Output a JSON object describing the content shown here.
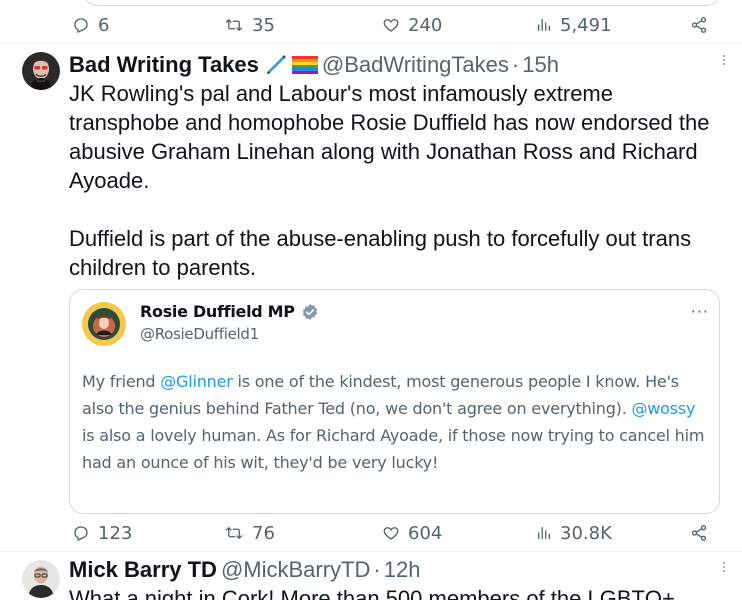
{
  "previous_tweet": {
    "actions": {
      "replies": "6",
      "retweets": "35",
      "likes": "240",
      "views": "5,491"
    }
  },
  "tweet1": {
    "author_name": "Bad Writing Takes",
    "author_emoji": [
      "pen-icon",
      "rainbow-flag-icon"
    ],
    "handle": "@BadWritingTakes",
    "separator": "·",
    "time": "15h",
    "paragraphs": [
      "JK Rowling's pal and Labour's most infamously extreme transphobe and homophobe Rosie Duffield has now endorsed the abusive Graham Linehan along with Jonathan Ross and Richard Ayoade.",
      "Duffield is part of the abuse-enabling push to forcefully out trans children to parents."
    ],
    "quoted": {
      "author_name": "Rosie Duffield MP",
      "verified": true,
      "handle": "@RosieDuffield1",
      "more": "···",
      "text_segments": [
        {
          "text": "My friend ",
          "mention": false
        },
        {
          "text": "@Glinner",
          "mention": true
        },
        {
          "text": " is one of the kindest, most generous people I know. He's also the genius behind Father Ted (no, we don't agree on everything). ",
          "mention": false
        },
        {
          "text": "@wossy",
          "mention": true
        },
        {
          "text": " is also a lovely human. As for Richard Ayoade, if those now trying to cancel him had an ounce of his wit, they'd be very lucky!",
          "mention": false
        }
      ]
    },
    "actions": {
      "replies": "123",
      "retweets": "76",
      "likes": "604",
      "views": "30.8K"
    }
  },
  "tweet2": {
    "author_name": "Mick Barry TD",
    "handle": "@MickBarryTD",
    "separator": "·",
    "time": "12h",
    "body_start": "What a night in Cork! More than 500 members of the LGBTQ+"
  },
  "colors": {
    "text_primary": "#0f1419",
    "text_secondary": "#536471",
    "link": "#1d9bf0",
    "verified_badge": "#829aab",
    "border": "#cfd9de"
  }
}
